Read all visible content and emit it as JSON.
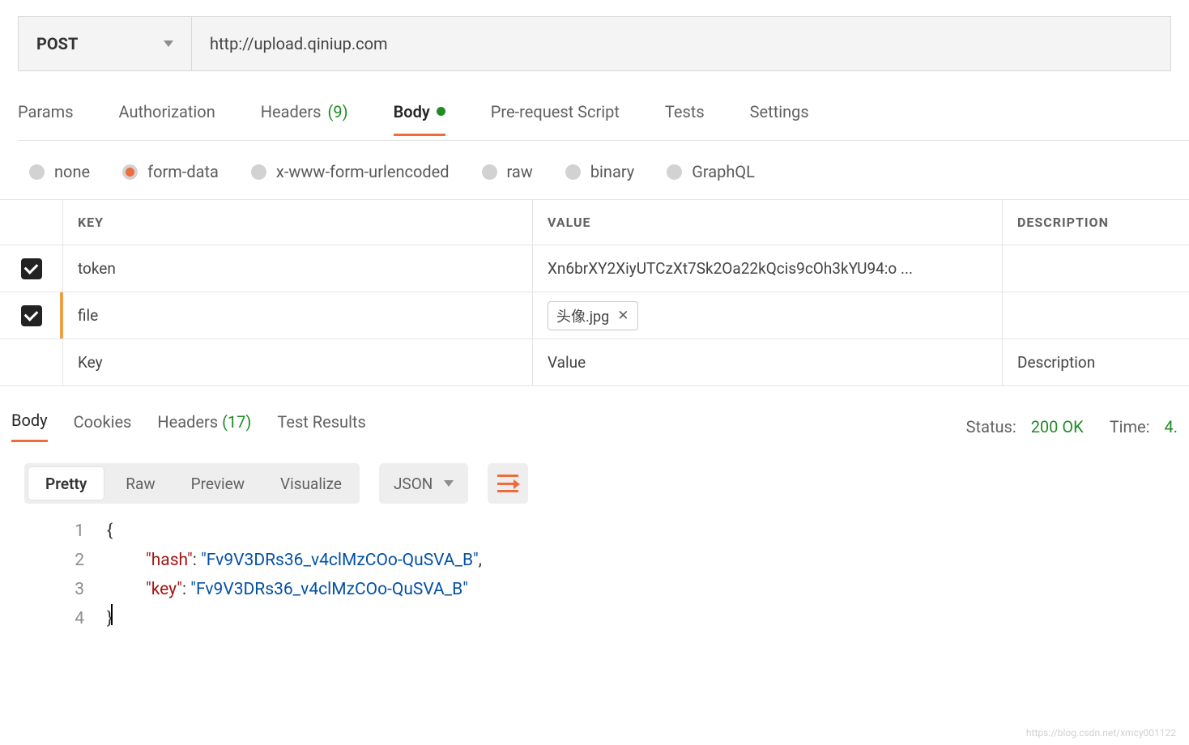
{
  "request": {
    "method": "POST",
    "url": "http://upload.qiniup.com"
  },
  "tabs": {
    "params": "Params",
    "authorization": "Authorization",
    "headers": "Headers",
    "headers_count": "(9)",
    "body": "Body",
    "prerequest": "Pre-request Script",
    "tests": "Tests",
    "settings": "Settings"
  },
  "body_types": {
    "none": "none",
    "formdata": "form-data",
    "xwww": "x-www-form-urlencoded",
    "raw": "raw",
    "binary": "binary",
    "graphql": "GraphQL"
  },
  "table": {
    "head_key": "KEY",
    "head_value": "VALUE",
    "head_desc": "DESCRIPTION",
    "rows": [
      {
        "key": "token",
        "value": "Xn6brXY2XiyUTCzXt7Sk2Oa22kQcis9cOh3kYU94:o ..."
      },
      {
        "key": "file",
        "file": "头像.jpg"
      }
    ],
    "placeholder_key": "Key",
    "placeholder_value": "Value",
    "placeholder_desc": "Description"
  },
  "response": {
    "tab_body": "Body",
    "tab_cookies": "Cookies",
    "tab_headers": "Headers",
    "headers_count": "(17)",
    "tab_tests": "Test Results",
    "status_label": "Status:",
    "status_value": "200 OK",
    "time_label": "Time:",
    "time_value": "4."
  },
  "view": {
    "pretty": "Pretty",
    "raw": "Raw",
    "preview": "Preview",
    "visualize": "Visualize",
    "format": "JSON"
  },
  "json": {
    "line1": "{",
    "k1": "\"hash\"",
    "v1": "\"Fv9V3DRs36_v4clMzCOo-QuSVA_B\"",
    "k2": "\"key\"",
    "v2": "\"Fv9V3DRs36_v4clMzCOo-QuSVA_B\"",
    "line4": "}"
  },
  "watermark": "https://blog.csdn.net/xmcy001122"
}
